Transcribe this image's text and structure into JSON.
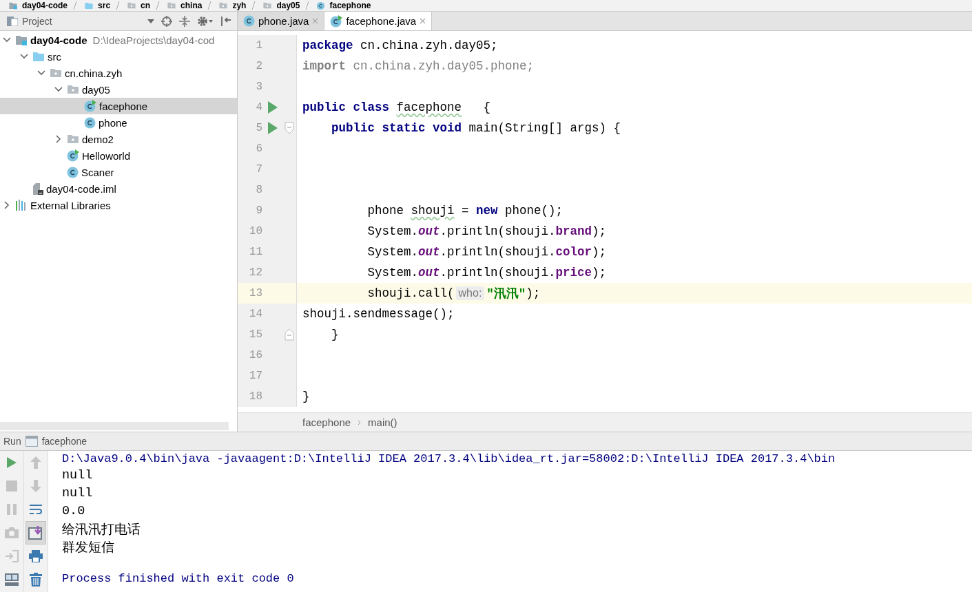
{
  "nav_bar": [
    {
      "label": "day04-code",
      "kind": "module"
    },
    {
      "label": "src",
      "kind": "source-folder"
    },
    {
      "label": "cn",
      "kind": "package"
    },
    {
      "label": "china",
      "kind": "package"
    },
    {
      "label": "zyh",
      "kind": "package"
    },
    {
      "label": "day05",
      "kind": "package"
    },
    {
      "label": "facephone",
      "kind": "class"
    }
  ],
  "project_panel": {
    "title": "Project",
    "tree": [
      {
        "label": "day04-code",
        "path": "D:\\IdeaProjects\\day04-cod",
        "kind": "module",
        "expanded": true,
        "selected": false,
        "children": [
          {
            "label": "src",
            "kind": "source-folder",
            "expanded": true,
            "selected": false,
            "children": [
              {
                "label": "cn.china.zyh",
                "kind": "package",
                "expanded": true,
                "selected": false,
                "children": [
                  {
                    "label": "day05",
                    "kind": "package",
                    "expanded": true,
                    "selected": false,
                    "children": [
                      {
                        "label": "facephone",
                        "kind": "runnable-class",
                        "selected": true
                      },
                      {
                        "label": "phone",
                        "kind": "class",
                        "selected": false
                      }
                    ]
                  },
                  {
                    "label": "demo2",
                    "kind": "package",
                    "expanded": false,
                    "selected": false
                  },
                  {
                    "label": "Helloworld",
                    "kind": "runnable-class",
                    "selected": false
                  },
                  {
                    "label": "Scaner",
                    "kind": "class",
                    "selected": false
                  }
                ]
              }
            ]
          },
          {
            "label": "day04-code.iml",
            "kind": "iml",
            "selected": false
          }
        ]
      },
      {
        "label": "External Libraries",
        "kind": "libraries",
        "expanded": false,
        "selected": false
      }
    ]
  },
  "tabs": [
    {
      "label": "phone.java",
      "kind": "class",
      "selected": false
    },
    {
      "label": "facephone.java",
      "kind": "runnable-class",
      "selected": true
    }
  ],
  "editor": {
    "lines": [
      {
        "number": "1",
        "kind": "plain",
        "current": false,
        "tokens": [
          {
            "kind": "keyword",
            "text": "package"
          },
          {
            "kind": "plain",
            "text": " cn.china.zyh.day05;"
          }
        ]
      },
      {
        "number": "2",
        "kind": "plain",
        "current": false,
        "tokens": [
          {
            "kind": "unused-keyword",
            "text": "import"
          },
          {
            "kind": "unused",
            "text": " cn.china.zyh.day05.phone;"
          }
        ]
      },
      {
        "number": "3",
        "kind": "plain",
        "current": false
      },
      {
        "number": "4",
        "kind": "run",
        "current": false,
        "tokens": [
          {
            "kind": "keyword",
            "text": "public class "
          },
          {
            "kind": "typo",
            "text": "facephone"
          },
          {
            "kind": "plain",
            "text": "   {"
          }
        ]
      },
      {
        "number": "5",
        "kind": "run-fold-start",
        "current": false,
        "tokens": [
          {
            "kind": "keyword",
            "text": "    public static void"
          },
          {
            "kind": "plain",
            "text": " main(String[] args) {"
          }
        ]
      },
      {
        "number": "6",
        "kind": "plain",
        "current": false
      },
      {
        "number": "7",
        "kind": "plain",
        "current": false
      },
      {
        "number": "8",
        "kind": "plain",
        "current": false
      },
      {
        "number": "9",
        "kind": "plain",
        "current": false,
        "tokens": [
          {
            "kind": "plain",
            "text": "         phone "
          },
          {
            "kind": "typo",
            "text": "shouji"
          },
          {
            "kind": "plain",
            "text": " = "
          },
          {
            "kind": "keyword",
            "text": "new"
          },
          {
            "kind": "plain",
            "text": " phone();"
          }
        ]
      },
      {
        "number": "10",
        "kind": "plain",
        "current": false,
        "tokens": [
          {
            "kind": "plain",
            "text": "         System."
          },
          {
            "kind": "static",
            "text": "out"
          },
          {
            "kind": "plain",
            "text": ".println(shouji."
          },
          {
            "kind": "field",
            "text": "brand"
          },
          {
            "kind": "plain",
            "text": ");"
          }
        ]
      },
      {
        "number": "11",
        "kind": "plain",
        "current": false,
        "tokens": [
          {
            "kind": "plain",
            "text": "         System."
          },
          {
            "kind": "static",
            "text": "out"
          },
          {
            "kind": "plain",
            "text": ".println(shouji."
          },
          {
            "kind": "field",
            "text": "color"
          },
          {
            "kind": "plain",
            "text": ");"
          }
        ]
      },
      {
        "number": "12",
        "kind": "plain",
        "current": false,
        "tokens": [
          {
            "kind": "plain",
            "text": "         System."
          },
          {
            "kind": "static",
            "text": "out"
          },
          {
            "kind": "plain",
            "text": ".println(shouji."
          },
          {
            "kind": "field",
            "text": "price"
          },
          {
            "kind": "plain",
            "text": ");"
          }
        ]
      },
      {
        "number": "13",
        "kind": "plain",
        "current": true,
        "tokens": [
          {
            "kind": "plain",
            "text": "         shouji.call("
          },
          {
            "kind": "hint",
            "text": "who:"
          },
          {
            "kind": "string",
            "text": "\"汛汛\""
          },
          {
            "kind": "plain",
            "text": ");"
          }
        ]
      },
      {
        "number": "14",
        "kind": "plain",
        "current": false,
        "tokens": [
          {
            "kind": "plain",
            "text": "shouji.sendmessage();"
          }
        ]
      },
      {
        "number": "15",
        "kind": "fold-end",
        "current": false,
        "tokens": [
          {
            "kind": "plain",
            "text": "    }"
          }
        ]
      },
      {
        "number": "16",
        "kind": "plain",
        "current": false
      },
      {
        "number": "17",
        "kind": "plain",
        "current": false
      },
      {
        "number": "18",
        "kind": "plain",
        "current": false,
        "tokens": [
          {
            "kind": "plain",
            "text": "}"
          }
        ]
      }
    ],
    "breadcrumb": [
      "facephone",
      "main()"
    ]
  },
  "run_panel": {
    "title": "Run",
    "config": "facephone",
    "left_tools": [
      {
        "kind": "run",
        "disabled": false
      },
      {
        "kind": "stop",
        "disabled": true
      },
      {
        "kind": "pause",
        "disabled": true
      },
      {
        "kind": "camera",
        "disabled": true
      },
      {
        "kind": "exit",
        "disabled": true
      },
      {
        "kind": "layout",
        "disabled": false
      }
    ],
    "right_tools": [
      {
        "kind": "up",
        "selected": false
      },
      {
        "kind": "down",
        "selected": false
      },
      {
        "kind": "wrap",
        "selected": false
      },
      {
        "kind": "scroll-end",
        "selected": true
      },
      {
        "kind": "print",
        "selected": false
      },
      {
        "kind": "trash",
        "selected": false
      }
    ],
    "output": [
      {
        "kind": "command",
        "text": "D:\\Java9.0.4\\bin\\java -javaagent:D:\\IntelliJ IDEA 2017.3.4\\lib\\idea_rt.jar=58002:D:\\IntelliJ IDEA 2017.3.4\\bin"
      },
      {
        "kind": "stdout",
        "text": "null"
      },
      {
        "kind": "stdout",
        "text": "null"
      },
      {
        "kind": "stdout",
        "text": "0.0"
      },
      {
        "kind": "stdout",
        "text": "给汛汛打电话"
      },
      {
        "kind": "stdout",
        "text": "群发短信"
      },
      {
        "kind": "exit",
        "text": "Process finished with exit code 0"
      }
    ]
  }
}
